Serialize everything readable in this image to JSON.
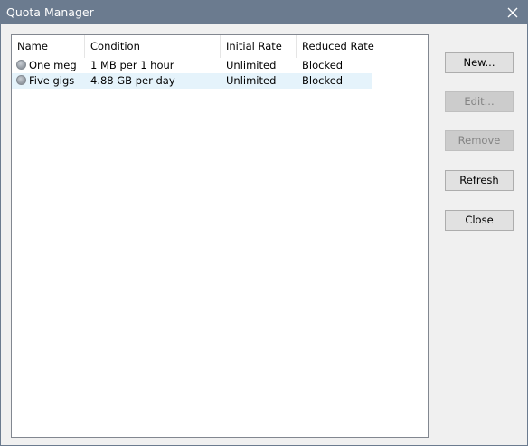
{
  "window": {
    "title": "Quota Manager"
  },
  "quota_table": {
    "columns": [
      "Name",
      "Condition",
      "Initial Rate",
      "Reduced Rate"
    ],
    "rows": [
      {
        "name": "One meg",
        "condition": "1 MB per 1 hour",
        "initial_rate": "Unlimited",
        "reduced_rate": "Blocked",
        "selected": false
      },
      {
        "name": "Five gigs",
        "condition": "4.88 GB per day",
        "initial_rate": "Unlimited",
        "reduced_rate": "Blocked",
        "selected": true
      }
    ]
  },
  "buttons": {
    "new": {
      "label": "New...",
      "enabled": true
    },
    "edit": {
      "label": "Edit...",
      "enabled": false
    },
    "remove": {
      "label": "Remove",
      "enabled": false
    },
    "refresh": {
      "label": "Refresh",
      "enabled": true
    },
    "close": {
      "label": "Close",
      "enabled": true
    }
  },
  "colors": {
    "titlebar": "#6b7b8f",
    "selection": "#e5f3fb",
    "dialog_background": "#f0f0f0"
  },
  "icons": {
    "close": "close-icon",
    "row_status": "gray-circle-status-icon"
  }
}
